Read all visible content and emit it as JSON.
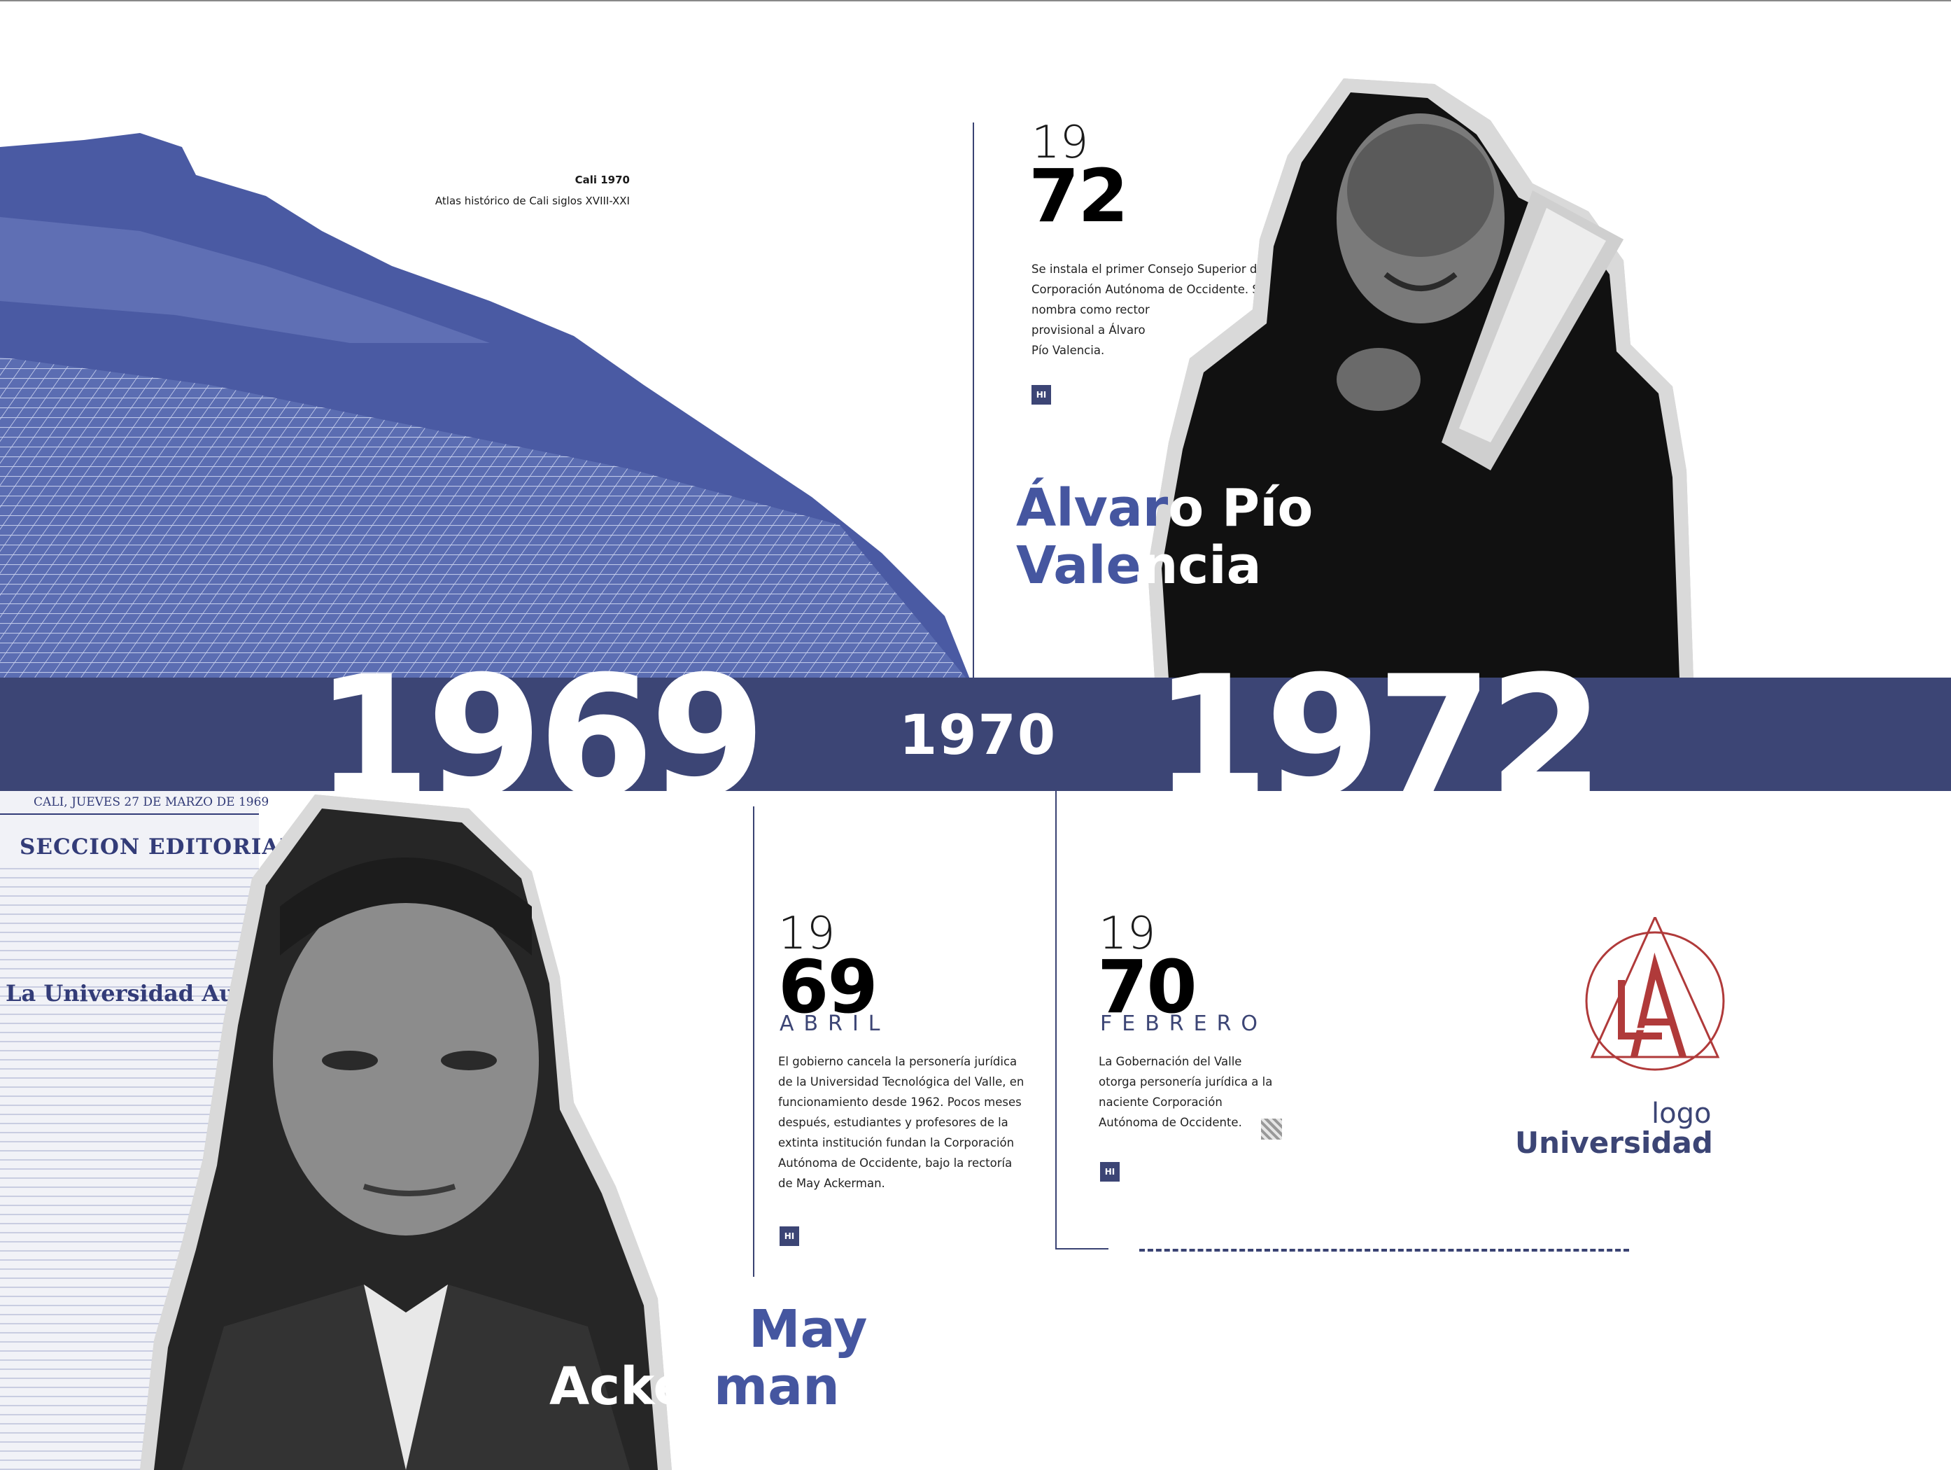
{
  "photo_caption": {
    "title": "Cali 1970",
    "subtitle": "Atlas histórico de Cali siglos XVIII-XXI"
  },
  "timeline_band": {
    "year_left": "1969",
    "year_middle": "1970",
    "year_right": "1972"
  },
  "milestones": {
    "m1972": {
      "prefix": "19",
      "suffix": "72",
      "text": [
        "Se instala el primer Consejo Superior de la",
        "Corporación Autónoma de Occidente. Se",
        "nombra como rector",
        "provisional a Álvaro",
        "Pío Valencia."
      ],
      "badge": "HI"
    },
    "m1969": {
      "prefix": "19",
      "suffix": "69",
      "month": "ABRIL",
      "text": [
        "El gobierno cancela la personería jurídica",
        "de la Universidad Tecnológica del Valle, en",
        "funcionamiento desde 1962. Pocos meses",
        "después, estudiantes y profesores de la",
        "extinta institución fundan la Corporación",
        "Autónoma de Occidente, bajo la rectoría",
        "de May Ackerman."
      ],
      "badge": "HI"
    },
    "m1970": {
      "prefix": "19",
      "suffix": "70",
      "month": "FEBRERO",
      "text": [
        "La Gobernación del Valle",
        "otorga personería jurídica a la",
        "naciente Corporación",
        "Autónoma de Occidente."
      ],
      "badge": "HI"
    }
  },
  "people": {
    "alvaro": {
      "line1_a": "Álvar",
      "line1_b": "o Pío",
      "line2_a": "Vale",
      "line2_b": "ncia"
    },
    "may": {
      "line1": "May",
      "line2_a": "Acker",
      "line2_b": "man"
    }
  },
  "newspaper": {
    "dateline": "CALI, JUEVES 27 DE MARZO DE 1969",
    "section": "SECCION EDITORIAL",
    "article_title": "La Universidad Autónom"
  },
  "logo": {
    "small": "logo",
    "big": "Universidad"
  },
  "colors": {
    "band": "#3c4575",
    "accent_blue": "#4556a0",
    "logo_red": "#b03a3a"
  }
}
